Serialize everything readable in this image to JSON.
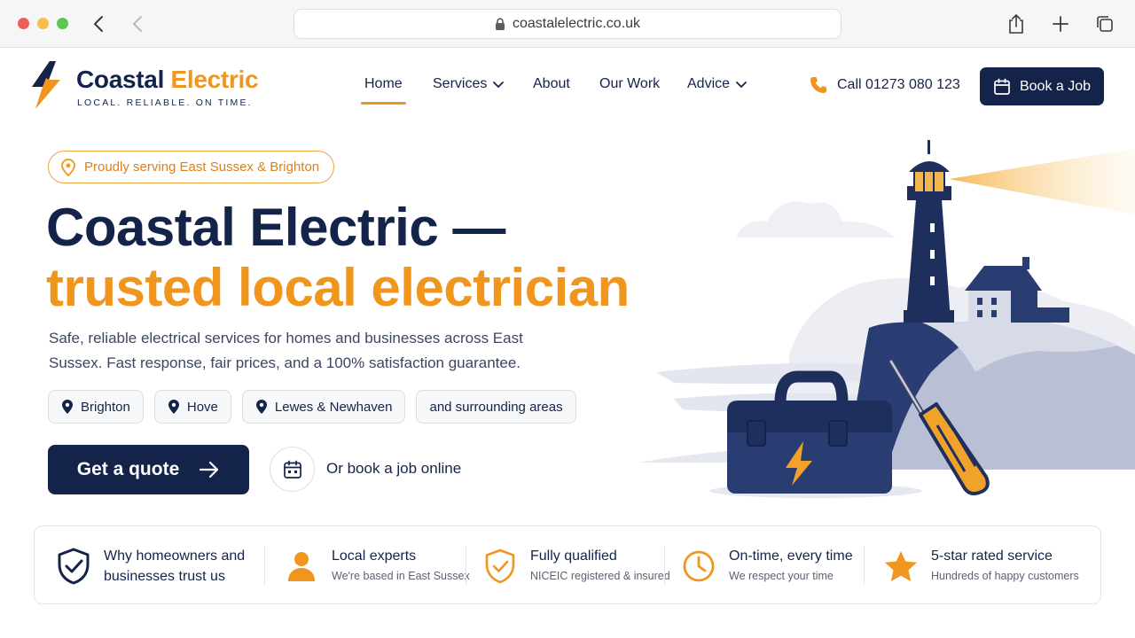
{
  "browser": {
    "url": "coastalelectric.co.uk"
  },
  "brand": {
    "name_part1": "Coastal",
    "name_part2": "Electric",
    "tagline": "LOCAL. RELIABLE. ON TIME.",
    "navy": "#13234a",
    "orange": "#f0961e"
  },
  "nav": {
    "items": [
      {
        "label": "Home",
        "active": true
      },
      {
        "label": "Services",
        "dropdown": true
      },
      {
        "label": "About"
      },
      {
        "label": "Our Work"
      },
      {
        "label": "Advice",
        "dropdown": true
      }
    ],
    "call_label": "Call 01273 080 123",
    "book_label": "Book a Job"
  },
  "hero": {
    "pill": "Proudly serving East Sussex & Brighton",
    "headline_line1": "Coastal Electric —",
    "headline_line2": "trusted local electrician",
    "lead": "Safe, reliable electrical services for homes and businesses across East Sussex. Fast response, fair prices, and a 100% satisfaction guarantee.",
    "areas": [
      "Brighton",
      "Hove",
      "Lewes & Newhaven",
      "and surrounding areas"
    ],
    "cta_label": "Get a quote",
    "book_online": "Or book a job online"
  },
  "trust": {
    "intro": "Why homeowners and businesses trust us",
    "items": [
      {
        "title": "Local experts",
        "subtitle": "We're based in East Sussex",
        "icon": "person-icon"
      },
      {
        "title": "Fully qualified",
        "subtitle": "NICEIC registered & insured",
        "icon": "shield-check-icon"
      },
      {
        "title": "On-time, every time",
        "subtitle": "We respect your time",
        "icon": "clock-icon"
      },
      {
        "title": "5-star rated service",
        "subtitle": "Hundreds of happy customers",
        "icon": "star-icon"
      }
    ]
  }
}
